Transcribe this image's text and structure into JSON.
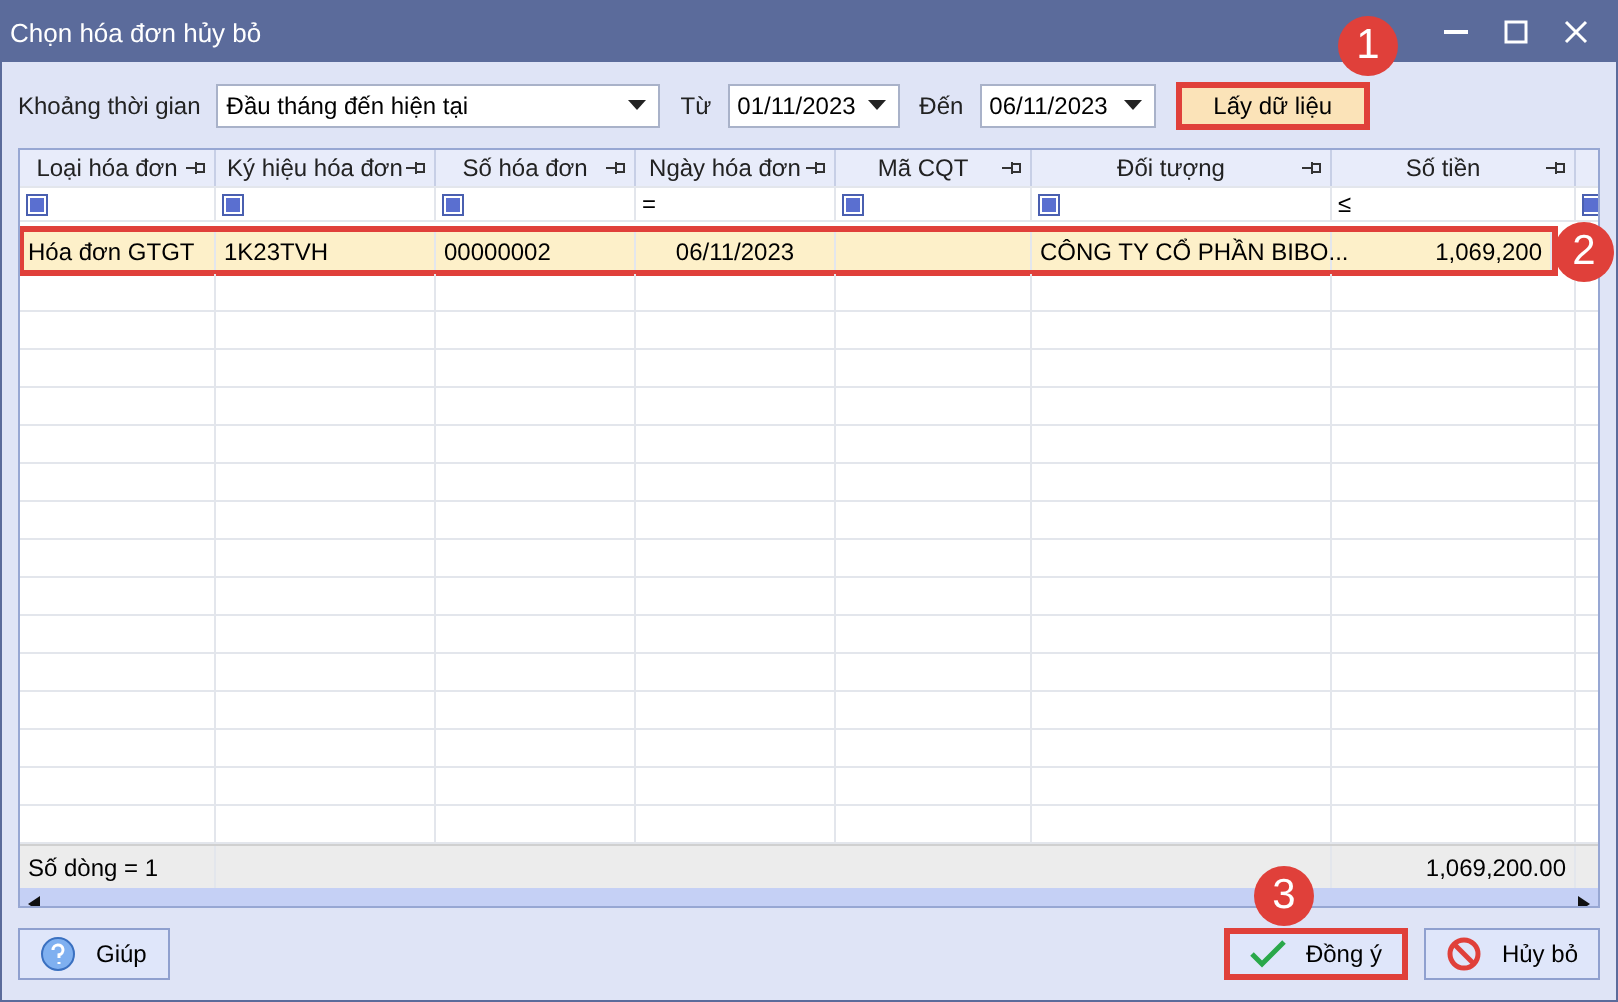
{
  "window": {
    "title": "Chọn hóa đơn hủy bỏ"
  },
  "filter_bar": {
    "period_label": "Khoảng thời gian",
    "period_value": "Đầu tháng đến hiện tại",
    "from_label": "Từ",
    "from_value": "01/11/2023",
    "to_label": "Đến",
    "to_value": "06/11/2023",
    "fetch_button": {
      "label": "Lấy dữ liệu",
      "highlighted": true
    }
  },
  "table": {
    "columns": [
      {
        "label": "Loại hóa đơn",
        "filter": {
          "kind": "icon"
        }
      },
      {
        "label": "Ký hiệu hóa đơn",
        "filter": {
          "kind": "icon"
        }
      },
      {
        "label": "Số hóa đơn",
        "filter": {
          "kind": "icon"
        }
      },
      {
        "label": "Ngày hóa đơn",
        "filter": {
          "kind": "text",
          "text": "="
        }
      },
      {
        "label": "Mã CQT",
        "filter": {
          "kind": "icon"
        }
      },
      {
        "label": "Đối tượng",
        "filter": {
          "kind": "icon"
        }
      },
      {
        "label": "Số tiền",
        "filter": {
          "kind": "text",
          "text": "≤"
        }
      }
    ],
    "rows": [
      {
        "cells": [
          "Hóa đơn GTGT",
          "1K23TVH",
          "00000002",
          "06/11/2023",
          "",
          "CÔNG TY CỔ PHẦN BIBO...",
          "1,069,200"
        ],
        "selected": true,
        "highlighted": true
      }
    ],
    "footer": {
      "count": "Số dòng = 1",
      "total": "1,069,200.00"
    }
  },
  "buttons": [
    {
      "kind": "help",
      "label": "Giúp",
      "highlighted": false
    },
    {
      "kind": "ok",
      "label": "Đồng ý",
      "highlighted": true
    },
    {
      "kind": "cancel",
      "label": "Hủy bỏ",
      "highlighted": false
    }
  ],
  "callouts": [
    "1",
    "2",
    "3"
  ]
}
